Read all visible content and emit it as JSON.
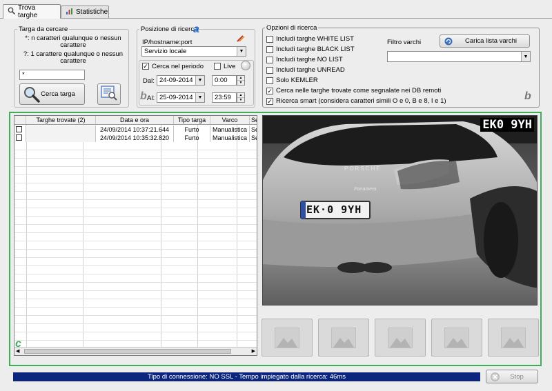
{
  "tabs": [
    {
      "label": "Trova targhe",
      "icon": "search-icon",
      "active": true
    },
    {
      "label": "Statistiche",
      "icon": "chart-icon",
      "active": false
    }
  ],
  "target": {
    "title": "Targa da cercare",
    "hint1": "*: n caratteri qualunque o nessun carattere",
    "hint2": "?: 1 carattere qualunque o nessun carattere",
    "input_value": "*",
    "search_button": "Cerca targa"
  },
  "position": {
    "title": "Posizione di ricerca",
    "ip_label": "IP/hostname:port",
    "ip_value": "Servizio locale",
    "period_label": "Cerca nel periodo",
    "period_checked": true,
    "live_label": "Live",
    "from_label": "Dal:",
    "from_date": "24-09-2014",
    "from_time": "0:00",
    "to_label": "Al:",
    "to_date": "25-09-2014",
    "to_time": "23:59"
  },
  "options": {
    "title": "Opzioni di ricerca",
    "checks": [
      {
        "label": "Includi targhe WHITE LIST",
        "checked": false
      },
      {
        "label": "Includi targhe BLACK LIST",
        "checked": false
      },
      {
        "label": "Includi targhe NO LIST",
        "checked": false
      },
      {
        "label": "Includi targhe UNREAD",
        "checked": false
      },
      {
        "label": "Solo KEMLER",
        "checked": false
      },
      {
        "label": "Cerca nelle targhe trovate come segnalate nei DB remoti",
        "checked": true
      },
      {
        "label": "Ricerca smart (considera caratteri simili O e 0, B e 8, I e 1)",
        "checked": true
      }
    ],
    "filter_label": "Filtro varchi",
    "load_button": "Carica lista varchi",
    "filter_value": ""
  },
  "annotations": {
    "a": "a",
    "b": "b",
    "c": "c"
  },
  "results": {
    "columns": [
      "Targhe trovate (2)",
      "Data e ora",
      "Tipo targa",
      "Varco",
      "Segna"
    ],
    "rows": [
      {
        "plate": "",
        "datetime": "24/09/2014 10:37:21.644",
        "type": "Furto",
        "gate": "Manualistica",
        "extra": "Segna"
      },
      {
        "plate": "",
        "datetime": "24/09/2014 10:35:32.820",
        "type": "Furto",
        "gate": "Manualistica",
        "extra": "Segna"
      }
    ]
  },
  "image": {
    "plate_overlay": "EK0 9YH",
    "plate_text": "EK·0 9YH",
    "brand_text": "PORSCHE",
    "model_text": "Panamera"
  },
  "status": {
    "text": "Tipo di connessione: NO SSL - Tempo impiegato dalla ricerca: 46ms",
    "stop_label": "Stop"
  },
  "colors": {
    "accent_letters": "#2a6fd6",
    "frame_green": "#3fae5a",
    "status_bar": "#0c2680"
  }
}
